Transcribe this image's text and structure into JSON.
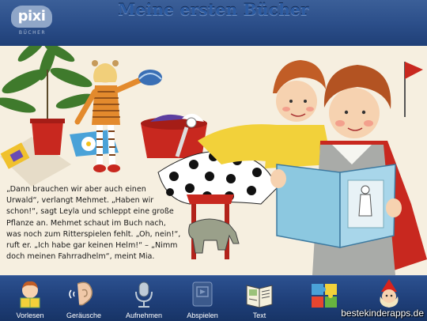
{
  "header": {
    "logo_text": "pixi",
    "logo_subtext": "BÜCHER",
    "title": "Meine ersten Bücher"
  },
  "story": {
    "text": "„Dann brauchen wir aber auch einen\nUrwald“, verlangt Mehmet. „Haben wir\nschon!“, sagt Leyla und schleppt eine große\nPflanze an. Mehmet schaut im Buch nach,\nwas noch zum Ritterspielen fehlt. „Oh, nein!“,\nruft er. „Ich habe gar keinen Helm!“ – „Nimm\ndoch meinen Fahrradhelm“, meint Mia."
  },
  "toolbar": {
    "items": [
      {
        "label": "Vorlesen",
        "icon": "reading-child-icon"
      },
      {
        "label": "Geräusche",
        "icon": "ear-icon"
      },
      {
        "label": "Aufnehmen",
        "icon": "microphone-icon"
      },
      {
        "label": "Abspielen",
        "icon": "play-icon"
      },
      {
        "label": "Text",
        "icon": "book-text-icon"
      },
      {
        "label": "",
        "icon": "puzzle-icon"
      },
      {
        "label": "",
        "icon": "gnome-icon"
      }
    ]
  },
  "watermark": "bestekinderapps.de"
}
